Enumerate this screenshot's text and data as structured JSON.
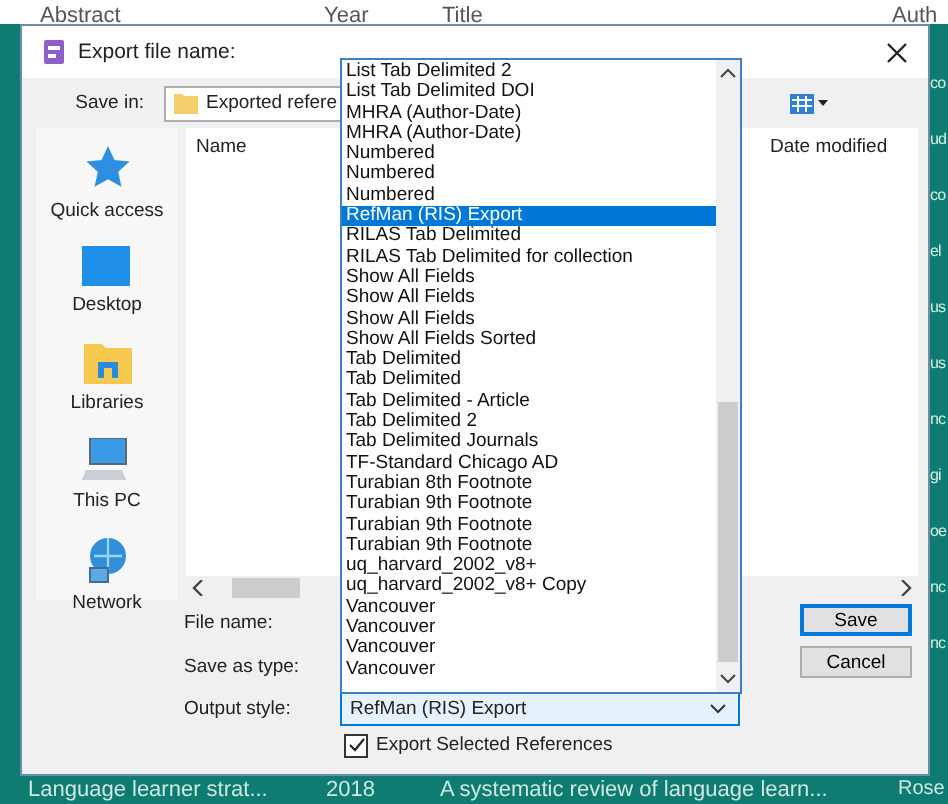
{
  "background_app": {
    "columns": [
      "Abstract",
      "Year",
      "Title",
      "Auth"
    ],
    "side_fragments": [
      "co",
      "ud",
      "co",
      "el",
      "us",
      "us",
      "nc",
      "gi",
      "oe",
      "nc",
      "nc"
    ],
    "bottom_row": [
      "Language learner strat...",
      "2018",
      "A systematic review of language learn...",
      "Rose"
    ]
  },
  "dialog": {
    "title": "Export file name:"
  },
  "save_in": {
    "label": "Save in:",
    "value": "Exported refere"
  },
  "places": [
    {
      "label": "Quick access",
      "kind": "star"
    },
    {
      "label": "Desktop",
      "kind": "desktop"
    },
    {
      "label": "Libraries",
      "kind": "library"
    },
    {
      "label": "This PC",
      "kind": "computer"
    },
    {
      "label": "Network",
      "kind": "network"
    }
  ],
  "file_list": {
    "columns": [
      "Name",
      "Date modified"
    ]
  },
  "fields": [
    {
      "label": "File name:"
    },
    {
      "label": "Save as type:"
    },
    {
      "label": "Output style:",
      "value": "RefMan (RIS) Export"
    }
  ],
  "style_list": [
    {
      "label": "List Tab Delimited 2",
      "selected": false
    },
    {
      "label": "List Tab Delimited DOI",
      "selected": false
    },
    {
      "label": "MHRA (Author-Date)",
      "selected": false
    },
    {
      "label": "MHRA (Author-Date)",
      "selected": false
    },
    {
      "label": "Numbered",
      "selected": false
    },
    {
      "label": "Numbered",
      "selected": false
    },
    {
      "label": "Numbered",
      "selected": false
    },
    {
      "label": "RefMan (RIS) Export",
      "selected": true
    },
    {
      "label": "RILAS Tab Delimited",
      "selected": false
    },
    {
      "label": "RILAS Tab Delimited for collection",
      "selected": false
    },
    {
      "label": "Show All Fields",
      "selected": false
    },
    {
      "label": "Show All Fields",
      "selected": false
    },
    {
      "label": "Show All Fields",
      "selected": false
    },
    {
      "label": "Show All Fields Sorted",
      "selected": false
    },
    {
      "label": "Tab Delimited",
      "selected": false
    },
    {
      "label": "Tab Delimited",
      "selected": false
    },
    {
      "label": "Tab Delimited - Article",
      "selected": false
    },
    {
      "label": "Tab Delimited 2",
      "selected": false
    },
    {
      "label": "Tab Delimited Journals",
      "selected": false
    },
    {
      "label": "TF-Standard Chicago AD",
      "selected": false
    },
    {
      "label": "Turabian 8th Footnote",
      "selected": false
    },
    {
      "label": "Turabian 9th Footnote",
      "selected": false
    },
    {
      "label": "Turabian 9th Footnote",
      "selected": false
    },
    {
      "label": "Turabian 9th Footnote",
      "selected": false
    },
    {
      "label": "uq_harvard_2002_v8+",
      "selected": false
    },
    {
      "label": "uq_harvard_2002_v8+ Copy",
      "selected": false
    },
    {
      "label": "Vancouver",
      "selected": false
    },
    {
      "label": "Vancouver",
      "selected": false
    },
    {
      "label": "Vancouver",
      "selected": false
    },
    {
      "label": "Vancouver",
      "selected": false
    }
  ],
  "export_selected": {
    "label": "Export Selected References",
    "checked": true
  },
  "buttons": [
    {
      "label": "Save",
      "default": true
    },
    {
      "label": "Cancel",
      "default": false
    }
  ]
}
